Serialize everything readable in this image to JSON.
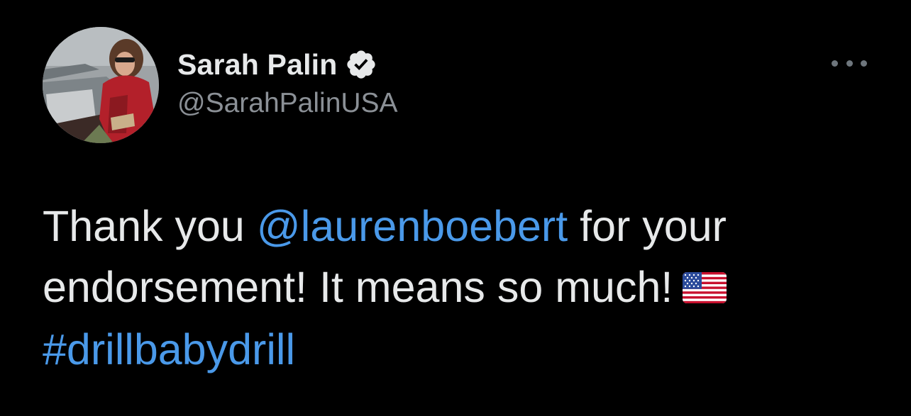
{
  "tweet": {
    "author": {
      "display_name": "Sarah Palin",
      "handle": "@SarahPalinUSA",
      "verified_icon": "verified-badge-icon",
      "avatar_icon": "profile-avatar"
    },
    "more_icon": "more-options-icon",
    "text": {
      "part1": "Thank you ",
      "mention": "@laurenboebert",
      "part2": " for your endorsement! It means so much!",
      "emoji": "us-flag-emoji",
      "hashtag": "#drillbabydrill"
    },
    "colors": {
      "background": "#000000",
      "text": "#e7e9ea",
      "secondary_text": "#8b9096",
      "link": "#4a99e9"
    }
  }
}
